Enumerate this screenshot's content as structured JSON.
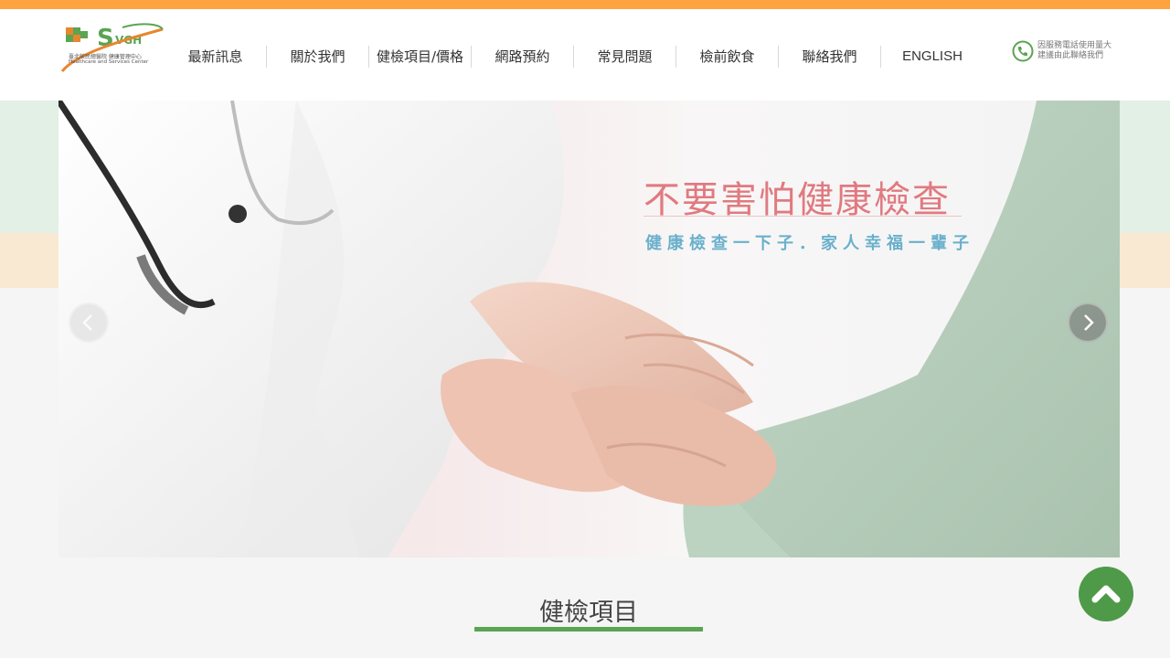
{
  "logo": {
    "mark": "HSVGH",
    "line1": "臺北榮民總醫院 健康管理中心",
    "line2": "Healthcare and Services Center"
  },
  "nav": {
    "items": [
      "最新訊息",
      "關於我們",
      "健檢項目/價格",
      "網路預約",
      "常見問題",
      "檢前飲食",
      "聯絡我們",
      "ENGLISH"
    ]
  },
  "phone_notice": {
    "line1": "因服務電話使用量大",
    "line2": "建議由此聯絡我們",
    "icon": "phone-icon"
  },
  "banner": {
    "headline": "不要害怕健康檢查",
    "subline": "健康檢查一下子．家人幸福一輩子",
    "prev_icon": "chevron-left-icon",
    "next_icon": "chevron-right-icon"
  },
  "section": {
    "title": "健檢項目"
  },
  "back_to_top": {
    "icon": "chevron-up-icon"
  },
  "colors": {
    "top_strip": "#ffa341",
    "brand_green": "#5aa452",
    "headline_pink": "#e07a80",
    "subline_blue": "#6ab0cc"
  }
}
